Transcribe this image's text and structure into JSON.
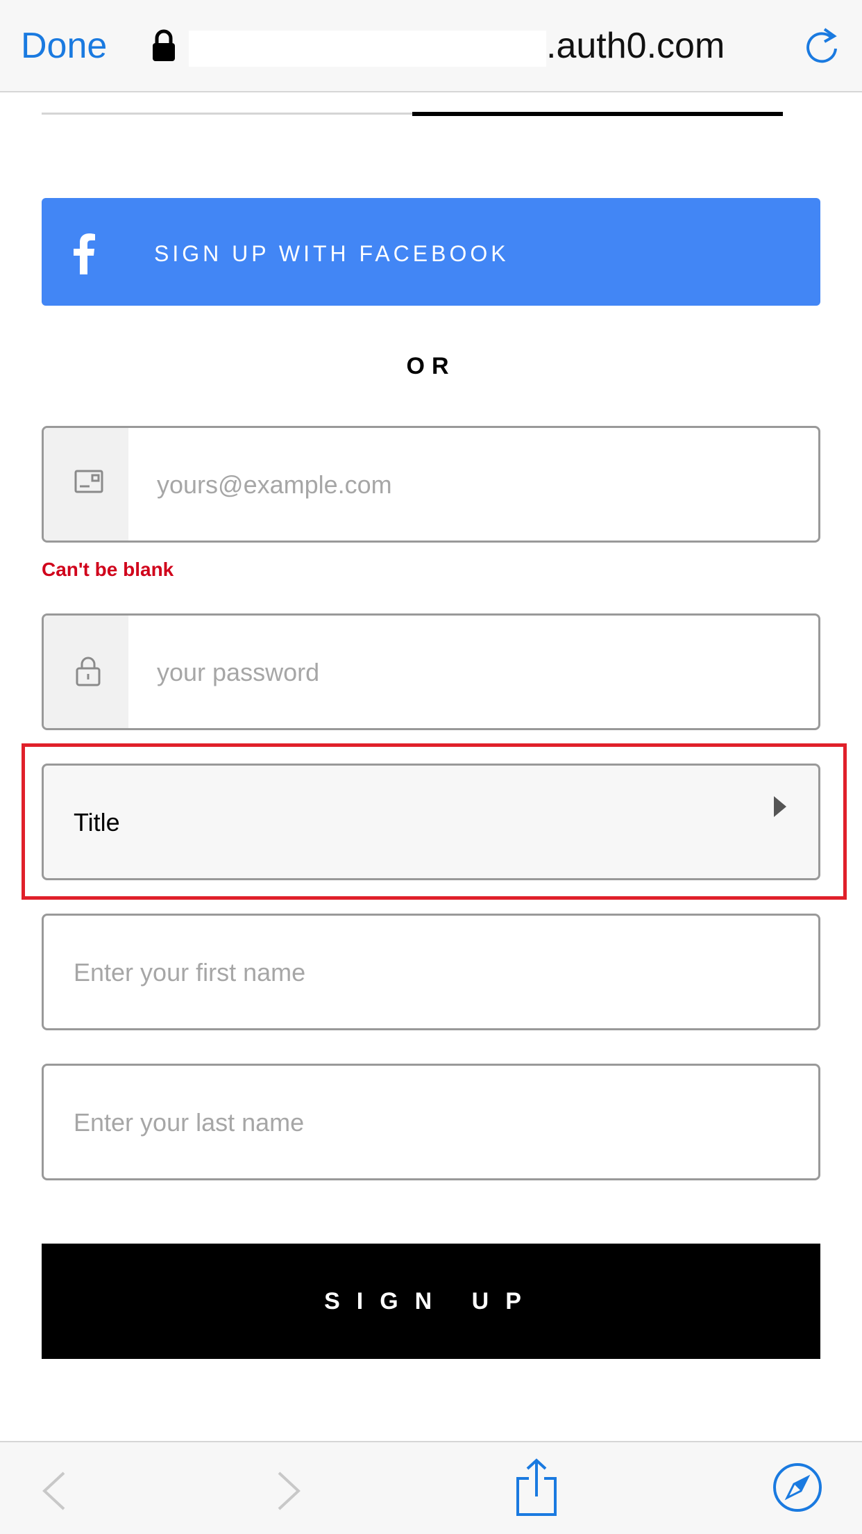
{
  "browser": {
    "done_label": "Done",
    "url_domain": ".auth0.com",
    "accent": "#1a7ae0"
  },
  "form": {
    "facebook_label": "SIGN UP WITH FACEBOOK",
    "facebook_color": "#4286f5",
    "or_label": "OR",
    "email": {
      "placeholder": "yours@example.com",
      "icon": "envelope-icon",
      "error": "Can't be blank"
    },
    "password": {
      "placeholder": "your password",
      "icon": "lock-icon"
    },
    "title_select": {
      "label": "Title"
    },
    "first_name": {
      "placeholder": "Enter your first name"
    },
    "last_name": {
      "placeholder": "Enter your last name"
    },
    "signup_label": "SIGN UP",
    "error_color": "#d0021b",
    "highlight_color": "#e0202a"
  },
  "toolbar": {
    "icons": [
      "back-icon",
      "forward-icon",
      "share-icon",
      "safari-compass-icon"
    ]
  }
}
